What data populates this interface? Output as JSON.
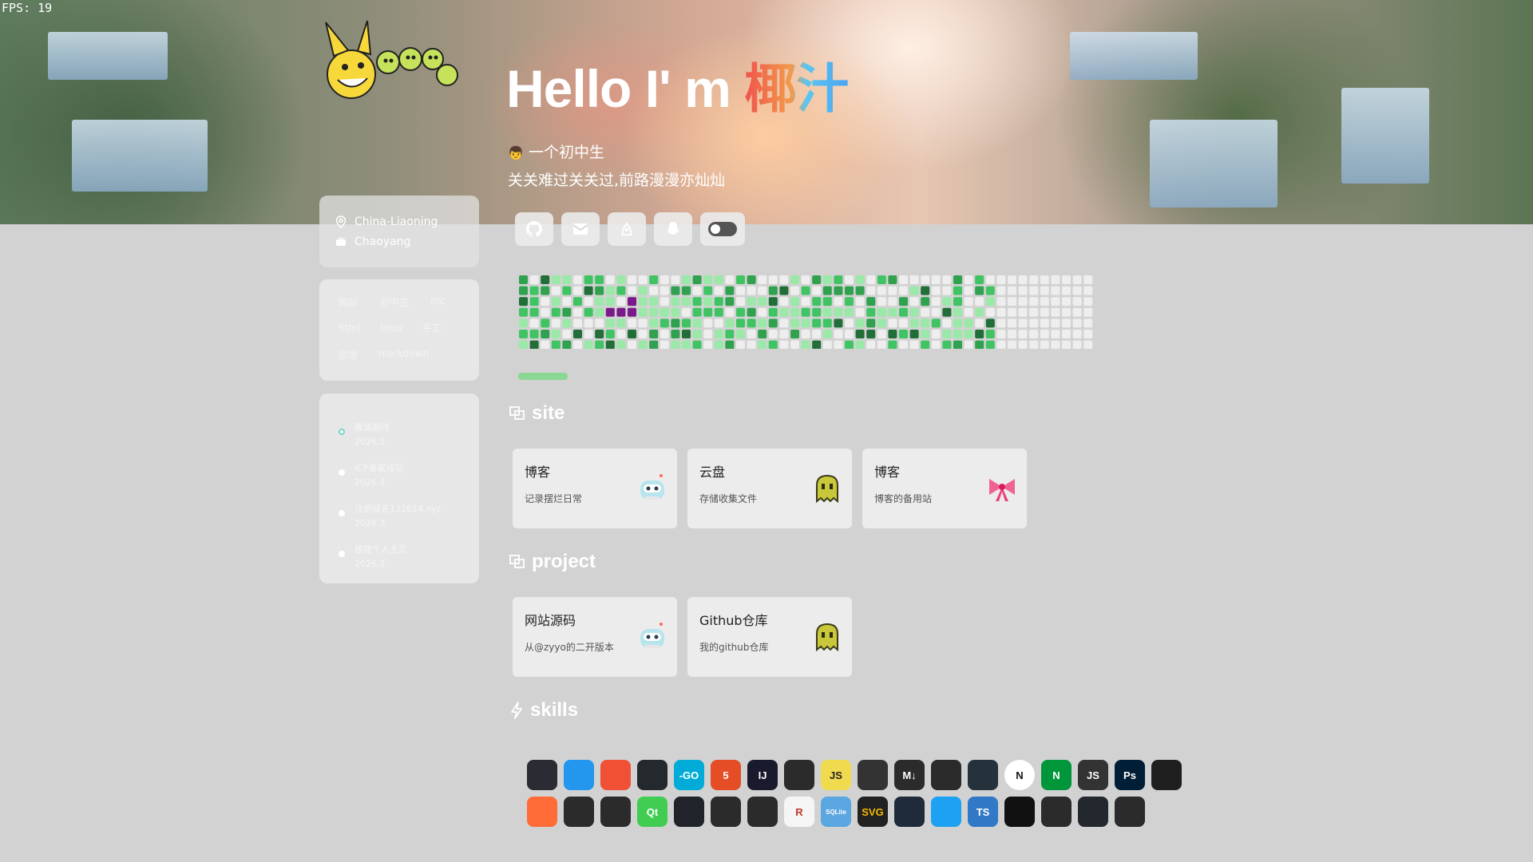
{
  "fps": "FPS: 19",
  "hero": {
    "greeting": "Hello I' m ",
    "name": "椰汁",
    "intro": "一个初中生",
    "motto": "关关难过关关过,前路漫漫亦灿灿"
  },
  "location": {
    "region": "China-Liaoning",
    "city": "Chaoyang"
  },
  "tags": [
    "网站",
    "初中生",
    "mc",
    "html",
    "linux",
    "手工",
    "前端",
    "markdown"
  ],
  "timeline": [
    {
      "title": "敬请期待",
      "date": "2026.5"
    },
    {
      "title": "ICP备案成功",
      "date": "2026.4"
    },
    {
      "title": "注册域名132614.xyz",
      "date": "2026.3"
    },
    {
      "title": "搭建个人主页",
      "date": "2026.2"
    }
  ],
  "sections": {
    "site": "site",
    "project": "project",
    "skills": "skills"
  },
  "site_tiles": [
    {
      "title": "博客",
      "desc": "记录摆烂日常",
      "icon": "robot-icon"
    },
    {
      "title": "云盘",
      "desc": "存储收集文件",
      "icon": "ghost-icon"
    },
    {
      "title": "博客",
      "desc": "博客的备用站",
      "icon": "ribbon-icon"
    }
  ],
  "project_tiles": [
    {
      "title": "网站源码",
      "desc": "从@zyyo的二开版本",
      "icon": "robot-icon"
    },
    {
      "title": "Github仓库",
      "desc": "我的github仓库",
      "icon": "ghost-icon"
    }
  ],
  "socials": [
    "github-icon",
    "mail-icon",
    "sketch-icon",
    "qq-icon",
    "theme-toggle"
  ],
  "skills_row1": [
    {
      "name": "bootstrap",
      "label": "",
      "color": "#2b2b33"
    },
    {
      "name": "docker",
      "label": "",
      "color": "#2396ed"
    },
    {
      "name": "git",
      "label": "",
      "color": "#f05033"
    },
    {
      "name": "github",
      "label": "",
      "color": "#24292e"
    },
    {
      "name": "go",
      "label": "-GO",
      "color": "#00acd7"
    },
    {
      "name": "html5",
      "label": "5",
      "color": "#e44d26"
    },
    {
      "name": "intellij",
      "label": "IJ",
      "color": "#1a1a2e"
    },
    {
      "name": "java",
      "label": "",
      "color": "#2b2b2b"
    },
    {
      "name": "javascript",
      "label": "JS",
      "color": "#f0db4f"
    },
    {
      "name": "linux",
      "label": "",
      "color": "#333333"
    },
    {
      "name": "markdown",
      "label": "M↓",
      "color": "#2b2b2b"
    },
    {
      "name": "mysql",
      "label": "",
      "color": "#2b2b2b"
    },
    {
      "name": "netlify",
      "label": "",
      "color": "#25313b"
    },
    {
      "name": "nextjs",
      "label": "N",
      "color": "#111111"
    },
    {
      "name": "nginx",
      "label": "N",
      "color": "#009639"
    },
    {
      "name": "nodejs",
      "label": "JS",
      "color": "#333333"
    },
    {
      "name": "photoshop",
      "label": "Ps",
      "color": "#001e36"
    },
    {
      "name": "planetscale",
      "label": "",
      "color": "#1f1f1f"
    }
  ],
  "skills_row2": [
    {
      "name": "postman",
      "label": "",
      "color": "#ff6c37"
    },
    {
      "name": "python",
      "label": "",
      "color": "#2b2b2b"
    },
    {
      "name": "raspberrypi",
      "label": "",
      "color": "#2b2b2b"
    },
    {
      "name": "qt",
      "label": "Qt",
      "color": "#41cd52"
    },
    {
      "name": "react",
      "label": "",
      "color": "#20232a"
    },
    {
      "name": "redis",
      "label": "",
      "color": "#2b2b2b"
    },
    {
      "name": "regex",
      "label": "",
      "color": "#2b2b2b"
    },
    {
      "name": "rust",
      "label": "R",
      "color": "#f5f5f5"
    },
    {
      "name": "sqlite",
      "label": "SQLite",
      "color": "#5aa6e0"
    },
    {
      "name": "svg",
      "label": "SVG",
      "color": "#222222"
    },
    {
      "name": "tailwind",
      "label": "",
      "color": "#1f2b3a"
    },
    {
      "name": "twitter",
      "label": "",
      "color": "#1da1f2"
    },
    {
      "name": "typescript",
      "label": "TS",
      "color": "#3178c6"
    },
    {
      "name": "vercel",
      "label": "",
      "color": "#111111"
    },
    {
      "name": "vite",
      "label": "",
      "color": "#2b2b2b"
    },
    {
      "name": "vscode",
      "label": "",
      "color": "#23272e"
    },
    {
      "name": "vue",
      "label": "",
      "color": "#2b2b2b"
    }
  ]
}
